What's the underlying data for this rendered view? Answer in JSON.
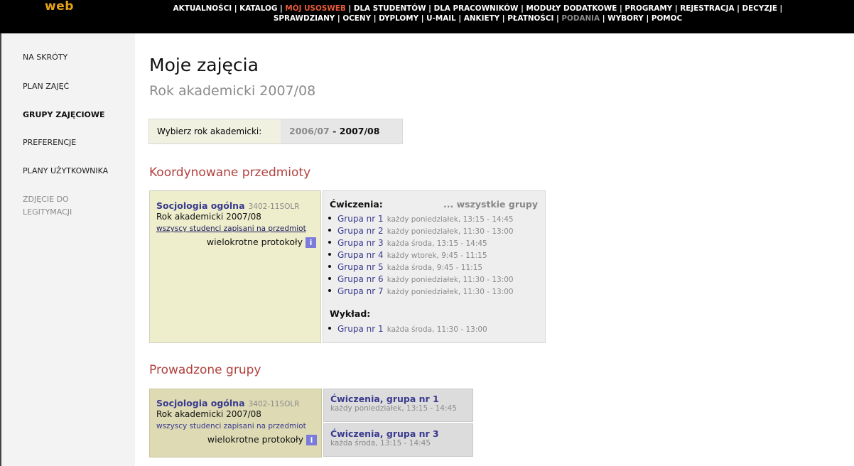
{
  "topbar": {
    "logo": "web",
    "row1": [
      {
        "label": "AKTUALNOŚCI",
        "state": "normal"
      },
      {
        "label": "KATALOG",
        "state": "normal"
      },
      {
        "label": "MÓJ USOSWEB",
        "state": "active"
      },
      {
        "label": "DLA STUDENTÓW",
        "state": "normal"
      },
      {
        "label": "DLA PRACOWNIKÓW",
        "state": "normal"
      },
      {
        "label": "MODUŁY DODATKOWE",
        "state": "normal"
      },
      {
        "label": "PROGRAMY",
        "state": "normal"
      },
      {
        "label": "REJESTRACJA",
        "state": "normal"
      },
      {
        "label": "DECYZJE",
        "state": "normal"
      }
    ],
    "row2": [
      {
        "label": "SPRAWDZIANY",
        "state": "normal"
      },
      {
        "label": "OCENY",
        "state": "normal"
      },
      {
        "label": "DYPLOMY",
        "state": "normal"
      },
      {
        "label": "U-MAIL",
        "state": "normal"
      },
      {
        "label": "ANKIETY",
        "state": "normal"
      },
      {
        "label": "PŁATNOŚCI",
        "state": "normal"
      },
      {
        "label": "PODANIA",
        "state": "disabled"
      },
      {
        "label": "WYBORY",
        "state": "normal"
      },
      {
        "label": "POMOC",
        "state": "normal"
      }
    ]
  },
  "sidebar": {
    "items": [
      {
        "label": "NA SKRÓTY"
      },
      {
        "label": "PLAN ZAJĘĆ"
      },
      {
        "label": "GRUPY ZAJĘCIOWE"
      },
      {
        "label": "PREFERENCJE"
      },
      {
        "label": "PLANY UŻYTKOWNIKA"
      }
    ],
    "disabled_item": {
      "line1": "ZDJĘCIE DO",
      "line2": "LEGITYMACJI"
    }
  },
  "main": {
    "title": "Moje zajęcia",
    "subtitle": "Rok akademicki 2007/08",
    "year_selector": {
      "label": "Wybierz rok akademicki:",
      "prev": "2006/07",
      "separator": "-",
      "current": "2007/08"
    },
    "coordinated": {
      "heading": "Koordynowane przedmioty",
      "course": {
        "name": "Socjologia ogólna",
        "code": "3402-11SOLR",
        "year": "Rok akademicki 2007/08",
        "students_link": "wszyscy studenci zapisani na przedmiot",
        "protocols": "wielokrotne protokoły",
        "info_icon": "i"
      },
      "all_groups": "... wszystkie grupy",
      "exercises_label": "Ćwiczenia",
      "exercises": [
        {
          "group": "Grupa nr 1",
          "when": "każdy poniedziałek, 13:15 - 14:45"
        },
        {
          "group": "Grupa nr 2",
          "when": "każdy poniedziałek, 11:30 - 13:00"
        },
        {
          "group": "Grupa nr 3",
          "when": "każda środa, 13:15 - 14:45"
        },
        {
          "group": "Grupa nr 4",
          "when": "każdy wtorek, 9:45 - 11:15"
        },
        {
          "group": "Grupa nr 5",
          "when": "każda środa, 9:45 - 11:15"
        },
        {
          "group": "Grupa nr 6",
          "when": "każdy poniedziałek, 11:30 - 13:00"
        },
        {
          "group": "Grupa nr 7",
          "when": "każdy poniedziałek, 11:30 - 13:00"
        }
      ],
      "lecture_label": "Wykład",
      "lectures": [
        {
          "group": "Grupa nr 1",
          "when": "każda środa, 11:30 - 13:00"
        }
      ]
    },
    "led": {
      "heading": "Prowadzone grupy",
      "course": {
        "name": "Socjologia ogólna",
        "code": "3402-11SOLR",
        "year": "Rok akademicki 2007/08",
        "students_link": "wszyscy studenci zapisani na przedmiot",
        "protocols": "wielokrotne protokoły",
        "info_icon": "i"
      },
      "groups": [
        {
          "title": "Ćwiczenia, grupa nr 1",
          "when": "każdy poniedziałek, 13:15 - 14:45"
        },
        {
          "title": "Ćwiczenia, grupa nr 3",
          "when": "każda środa, 13:15 - 14:45"
        }
      ]
    }
  }
}
